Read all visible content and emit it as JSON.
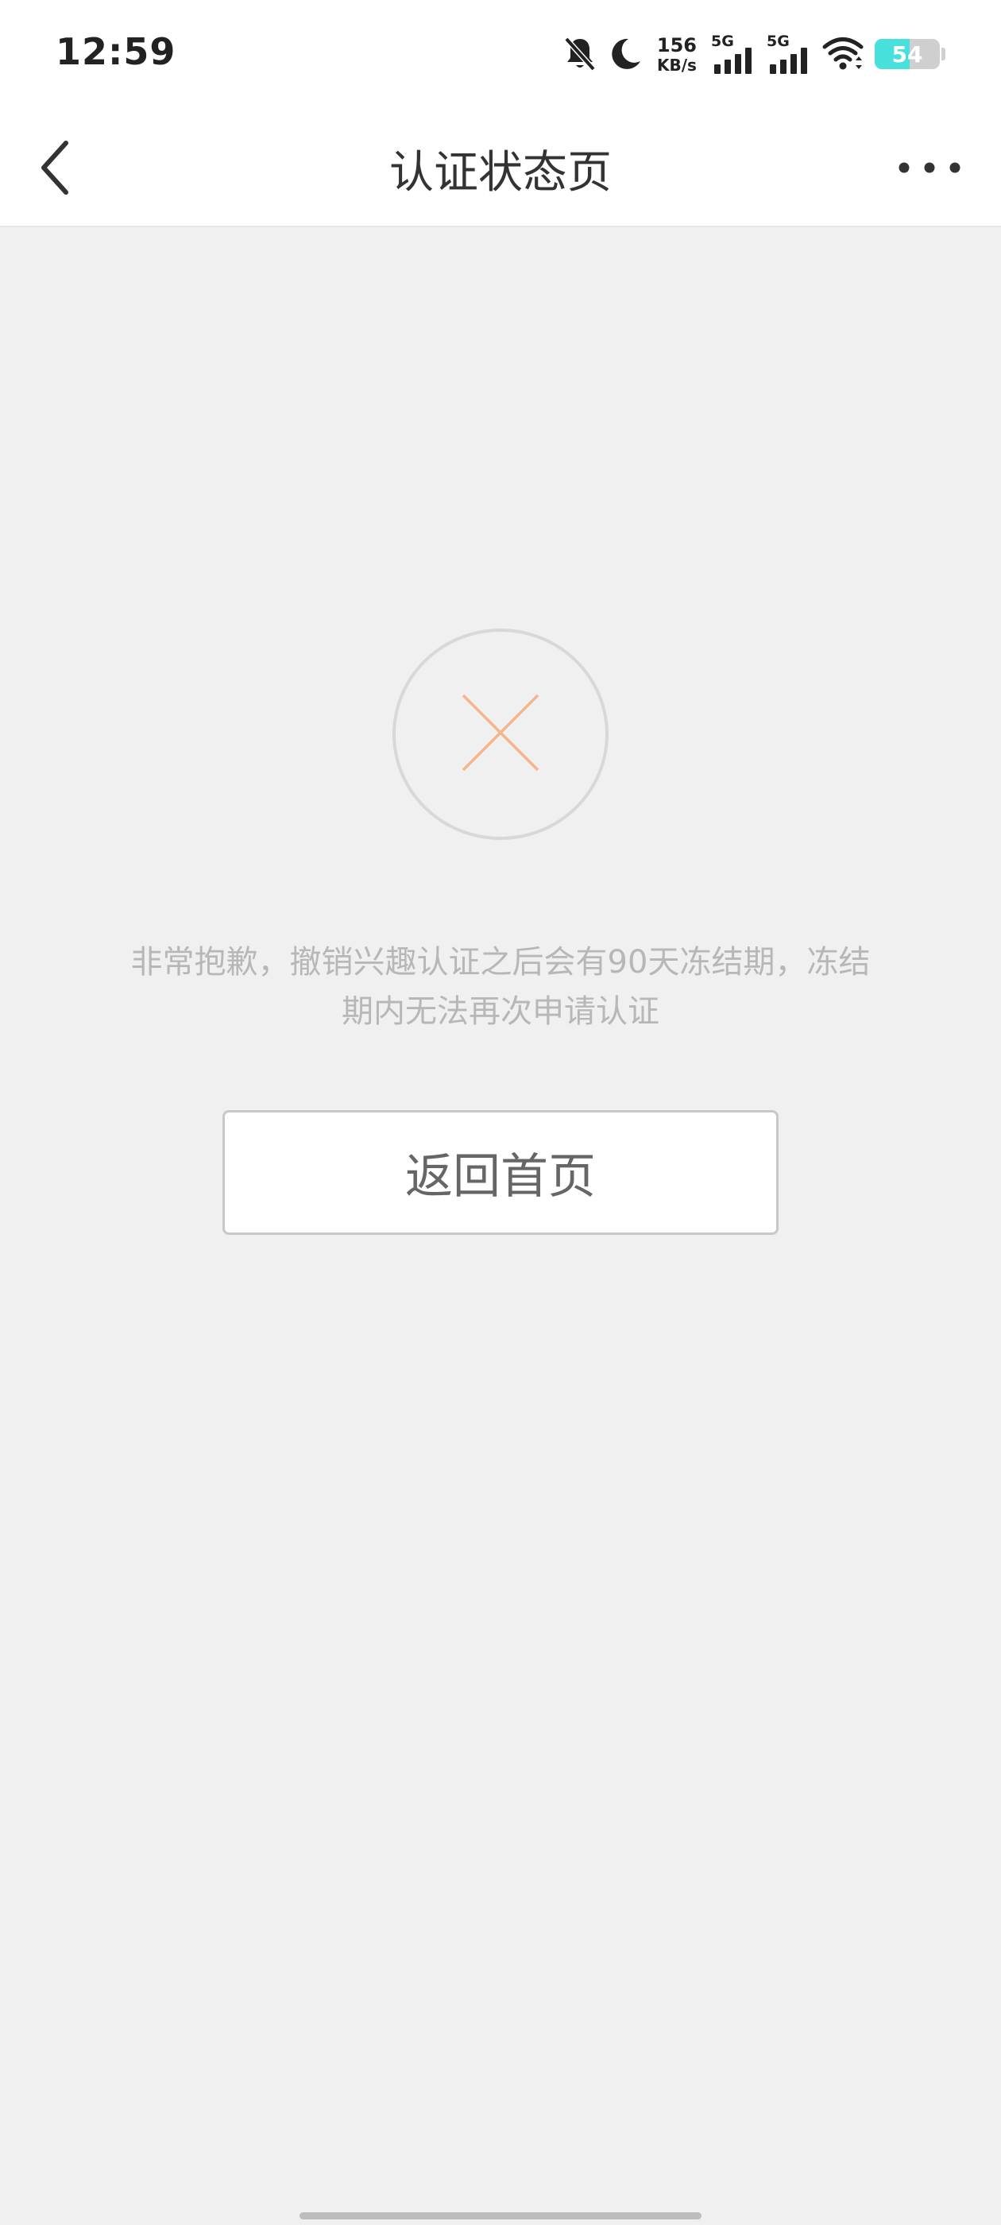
{
  "status_bar": {
    "time": "12:59",
    "net_speed_value": "156",
    "net_speed_unit": "KB/s",
    "sim1_tag": "5G",
    "sim2_tag": "5G",
    "battery_level": "54",
    "battery_fraction": 0.54,
    "icons": [
      "bell-muted-icon",
      "moon-icon",
      "signal-icon",
      "signal-icon",
      "wifi-icon",
      "battery-icon"
    ]
  },
  "nav": {
    "back_icon": "chevron-left-icon",
    "title": "认证状态页",
    "more_icon": "more-dots-icon"
  },
  "result": {
    "icon": "close-icon",
    "icon_color": "#f5b48a",
    "circle_color": "#d8d8d8",
    "message_line1": "非常抱歉，撤销兴趣认证之后会有90天冻结期，冻结",
    "message_line2": "期内无法再次申请认证"
  },
  "actions": {
    "home_button_label": "返回首页"
  },
  "colors": {
    "background": "#f0f0f0",
    "header": "#ffffff",
    "message_text": "#b7b7b7",
    "button_text": "#666666",
    "battery_fill": "#47e0dc"
  }
}
